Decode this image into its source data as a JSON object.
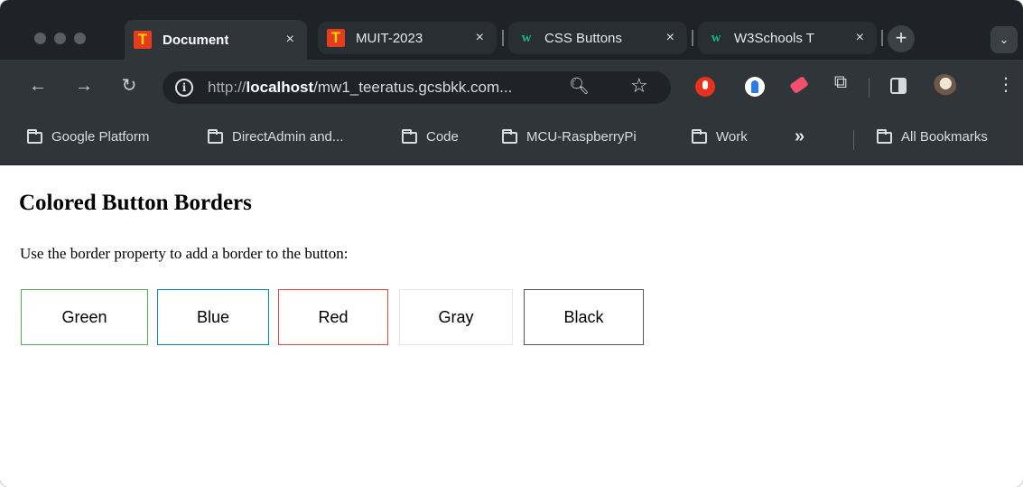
{
  "browser": {
    "tabs": [
      {
        "title": "Document",
        "favicon": "t-favicon",
        "active": true
      },
      {
        "title": "MUIT-2023",
        "favicon": "t-favicon",
        "active": false
      },
      {
        "title": "CSS Buttons",
        "favicon": "w3schools-favicon",
        "active": false
      },
      {
        "title": "W3Schools T",
        "favicon": "w3schools-favicon",
        "active": false
      }
    ],
    "close_glyph": "×",
    "new_tab_glyph": "+",
    "tab_menu_glyph": "⌄",
    "url": {
      "scheme": "http://",
      "host": "localhost",
      "rest": "/mw1_teeratus.gcsbkk.com..."
    },
    "bookmarks": [
      "Google Platform",
      "DirectAdmin and...",
      "Code",
      "MCU-RaspberryPi",
      "Work"
    ],
    "overflow_glyph": "»",
    "all_bookmarks": "All Bookmarks"
  },
  "page": {
    "heading": "Colored Button Borders",
    "description": "Use the border property to add a border to the button:",
    "buttons": [
      {
        "label": "Green",
        "border_color": "#4CAF50"
      },
      {
        "label": "Blue",
        "border_color": "#008CBA"
      },
      {
        "label": "Red",
        "border_color": "#f44336"
      },
      {
        "label": "Gray",
        "border_color": "#e7e7e7"
      },
      {
        "label": "Black",
        "border_color": "#555555"
      }
    ]
  }
}
